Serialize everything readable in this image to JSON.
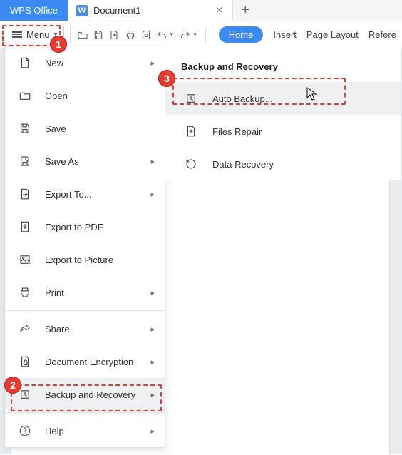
{
  "app_name": "WPS Office",
  "doc_tab": {
    "icon_letter": "W",
    "title": "Document1"
  },
  "menu_button_label": "Menu",
  "ribbon": {
    "home": "Home",
    "insert": "Insert",
    "page_layout": "Page Layout",
    "references": "Refere"
  },
  "menu_items": {
    "new": "New",
    "open": "Open",
    "save": "Save",
    "save_as": "Save As",
    "export_to": "Export To...",
    "export_pdf": "Export to PDF",
    "export_picture": "Export to Picture",
    "print": "Print",
    "share": "Share",
    "encryption": "Document Encryption",
    "backup": "Backup and Recovery",
    "help": "Help"
  },
  "submenu": {
    "title": "Backup and Recovery",
    "auto_backup": "Auto Backup...",
    "files_repair": "Files Repair",
    "data_recovery": "Data Recovery"
  },
  "annotations": {
    "a1": "1",
    "a2": "2",
    "a3": "3"
  }
}
